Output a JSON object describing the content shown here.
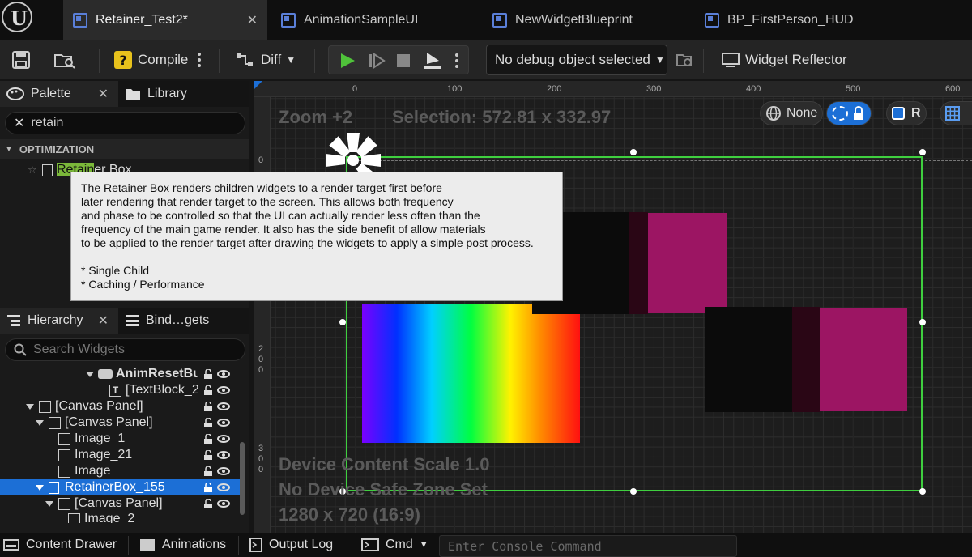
{
  "tabs": [
    {
      "label": "Retainer_Test2*",
      "active": true
    },
    {
      "label": "AnimationSampleUI",
      "active": false
    },
    {
      "label": "NewWidgetBlueprint",
      "active": false
    },
    {
      "label": "BP_FirstPerson_HUD",
      "active": false
    }
  ],
  "toolbar": {
    "compile_label": "Compile",
    "diff_label": "Diff",
    "debug_object": "No debug object selected",
    "widget_reflector_label": "Widget Reflector"
  },
  "palette": {
    "tab_palette": "Palette",
    "tab_library": "Library",
    "search_value": "retain",
    "category": "OPTIMIZATION",
    "item_highlight": "Retain",
    "item_rest": "er Box"
  },
  "tooltip": {
    "lines": [
      "The Retainer Box renders children widgets to a render target first before",
      "later rendering that render target to the screen.  This allows both frequency",
      "and phase to be controlled so that the UI can actually render less often than the",
      "frequency of the main game render.  It also has the side benefit of allow materials",
      "to be applied to the render target after drawing the widgets to apply a simple post process."
    ],
    "bullets": [
      "* Single Child",
      "* Caching / Performance"
    ]
  },
  "hierarchy": {
    "tab_hierarchy": "Hierarchy",
    "tab_bindings": "Bind…gets",
    "search_placeholder": "Search Widgets",
    "rows": [
      {
        "label": "AnimResetBut",
        "bold": true
      },
      {
        "label": "[TextBlock_2"
      },
      {
        "label": "[Canvas Panel]"
      },
      {
        "label": "[Canvas Panel]"
      },
      {
        "label": "Image_1"
      },
      {
        "label": "Image_21"
      },
      {
        "label": "Image"
      },
      {
        "label": "RetainerBox_155",
        "selected": true
      },
      {
        "label": "[Canvas Panel]"
      },
      {
        "label": "Image_2"
      }
    ]
  },
  "designer": {
    "zoom": "Zoom +2",
    "selection": "Selection: 572.81 x 332.97",
    "none_label": "None",
    "r_label": "R",
    "device_scale": "Device Content Scale 1.0",
    "safe_zone": "No Device Safe Zone Set",
    "resolution": "1280 x 720 (16:9)",
    "ruler_h": [
      "0",
      "100",
      "200",
      "300",
      "400",
      "500",
      "600"
    ],
    "ruler_v": [
      [
        "0"
      ],
      [
        "2",
        "0",
        "0"
      ],
      [
        "3",
        "0",
        "0"
      ]
    ],
    "colors": {
      "selection": "#3fcf3f",
      "magenta": "#9c1563",
      "accent": "#1c6fd6"
    }
  },
  "bottom": {
    "content_drawer": "Content Drawer",
    "animations": "Animations",
    "output_log": "Output Log",
    "cmd": "Cmd",
    "console_placeholder": "Enter Console Command"
  }
}
